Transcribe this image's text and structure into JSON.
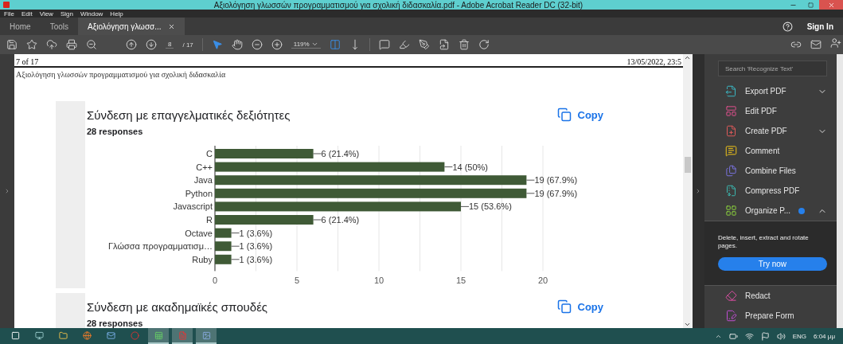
{
  "window": {
    "title": "Αξιολόγηση γλωσσών προγραμματισμού για σχολική διδασκαλία.pdf - Adobe Acrobat Reader DC (32-bit)"
  },
  "menu": [
    "File",
    "Edit",
    "View",
    "Sign",
    "Window",
    "Help"
  ],
  "tabs": [
    {
      "label": "Home",
      "selected": false
    },
    {
      "label": "Tools",
      "selected": false
    },
    {
      "label": "Αξιολόγηση γλωσσ...",
      "selected": true,
      "closable": true
    }
  ],
  "sign_in": "Sign In",
  "toolbar": {
    "page_current": "8",
    "page_total": "/ 17",
    "zoom": "119%"
  },
  "document": {
    "header_left": "7 of 17",
    "header_right": "13/05/2022, 23:5",
    "title": "Αξιολόγηση γλωσσών προγραμματισμού για σχολική διδασκαλία",
    "cards": [
      {
        "title": "Σύνδεση με επαγγελματικές δεξιότητες",
        "responses": "28 responses",
        "copy": "Copy",
        "chart_data": {
          "type": "bar",
          "orientation": "horizontal",
          "categories": [
            "C",
            "C++",
            "Java",
            "Python",
            "Javascript",
            "R",
            "Octave",
            "Γλώσσα προγραμματισμ…",
            "Ruby"
          ],
          "values": [
            6,
            14,
            19,
            19,
            15,
            6,
            1,
            1,
            1
          ],
          "xlim": [
            0,
            20
          ],
          "xticks": [
            0,
            5,
            10,
            15,
            20
          ],
          "grid": true,
          "value_labels": [
            "6 (21.4%)",
            "14 (50%)",
            "19 (67.9%)",
            "19 (67.9%)",
            "15 (53.6%)",
            "6 (21.4%)",
            "1 (3.6%)",
            "1 (3.6%)",
            "1 (3.6%)"
          ]
        }
      },
      {
        "title": "Σύνδεση με ακαδημαϊκές σπουδές",
        "responses": "28 responses",
        "copy": "Copy"
      }
    ]
  },
  "right_panel": {
    "search_placeholder": "Search 'Recognize Text'",
    "tools": [
      {
        "label": "Export PDF",
        "expanded": false
      },
      {
        "label": "Edit PDF"
      },
      {
        "label": "Create PDF",
        "expanded": false
      },
      {
        "label": "Comment"
      },
      {
        "label": "Combine Files"
      },
      {
        "label": "Compress PDF"
      },
      {
        "label": "Organize P...",
        "expanded": true,
        "badge": true
      }
    ],
    "promo": {
      "text": "Delete, insert, extract and rotate pages.",
      "button": "Try now"
    },
    "more_tools": [
      {
        "label": "Redact"
      },
      {
        "label": "Prepare Form"
      }
    ]
  },
  "taskbar": {
    "apps": [
      {
        "selected": false
      },
      {
        "selected": false
      },
      {
        "selected": false
      },
      {
        "selected": false
      },
      {
        "selected": false
      },
      {
        "selected": false
      },
      {
        "selected": true
      },
      {
        "selected": true
      },
      {
        "selected": true
      }
    ],
    "language": "ENG",
    "time": "6:04 μμ"
  }
}
